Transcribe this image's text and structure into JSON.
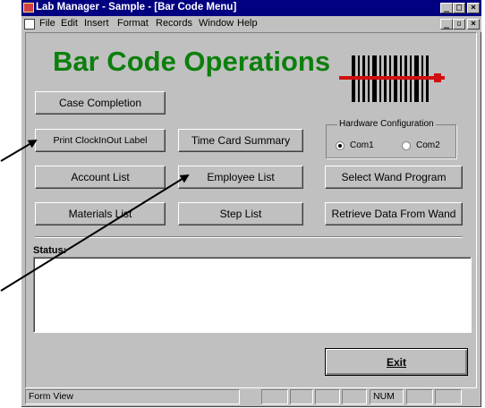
{
  "window": {
    "title": "Lab Manager - Sample - [Bar Code Menu]"
  },
  "menu": [
    "File",
    "Edit",
    "Insert",
    "Format",
    "Records",
    "Window",
    "Help"
  ],
  "heading": "Bar Code Operations",
  "buttons": {
    "case_completion": "Case Completion",
    "print_clock": "Print ClockInOut Label",
    "time_card": "Time Card Summary",
    "account_list": "Account List",
    "employee_list": "Employee List",
    "select_wand": "Select Wand Program",
    "materials_list": "Materials List",
    "step_list": "Step List",
    "retrieve_data": "Retrieve Data From Wand",
    "exit": "Exit"
  },
  "hardware": {
    "label": "Hardware Configuration",
    "options": [
      "Com1",
      "Com2"
    ],
    "selected": "Com1"
  },
  "status": {
    "label": "Status:",
    "text": ""
  },
  "statusbar": {
    "mode": "Form View",
    "num": "NUM"
  }
}
